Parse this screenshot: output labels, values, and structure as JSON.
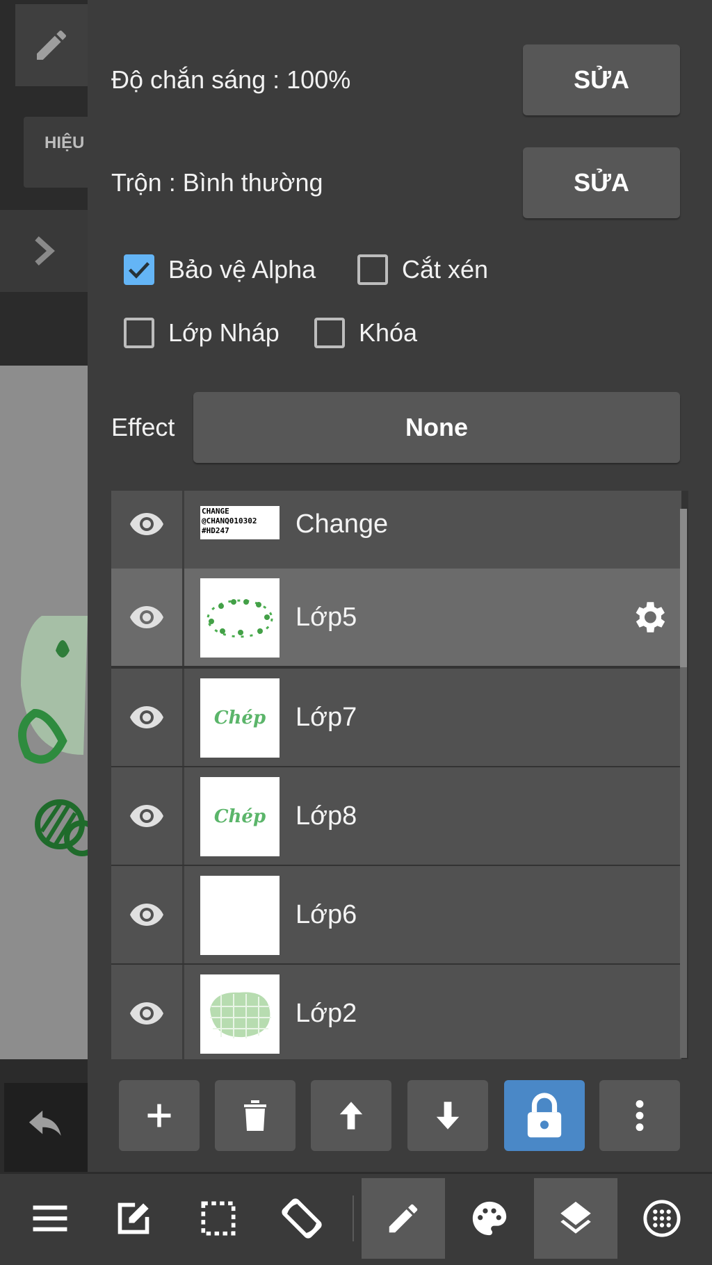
{
  "side_strip": {
    "effect_tab_label": "HIỆU"
  },
  "layer_properties": {
    "opacity_label": "Độ chắn sáng : 100%",
    "opacity_edit": "SỬA",
    "blend_label": "Trộn : Bình thường",
    "blend_edit": "SỬA",
    "checkboxes": [
      {
        "label": "Bảo vệ Alpha",
        "checked": true
      },
      {
        "label": "Cắt xén",
        "checked": false
      },
      {
        "label": "Lớp Nháp",
        "checked": false
      },
      {
        "label": "Khóa",
        "checked": false
      }
    ],
    "effect_label": "Effect",
    "effect_value": "None"
  },
  "layers": [
    {
      "name": "Change",
      "visible": true,
      "selected": false,
      "thumb_text": [
        "CHANGE",
        "@CHANQ010302",
        "#HD247"
      ]
    },
    {
      "name": "Lớp5",
      "visible": true,
      "selected": true
    },
    {
      "name": "Lớp7",
      "visible": true,
      "selected": false,
      "thumb_text": [
        "Chép"
      ]
    },
    {
      "name": "Lớp8",
      "visible": true,
      "selected": false,
      "thumb_text": [
        "Chép"
      ]
    },
    {
      "name": "Lớp6",
      "visible": true,
      "selected": false
    },
    {
      "name": "Lớp2",
      "visible": true,
      "selected": false
    }
  ],
  "layer_actions": [
    {
      "icon": "plus-icon"
    },
    {
      "icon": "trash-icon"
    },
    {
      "icon": "arrow-up-icon"
    },
    {
      "icon": "arrow-down-icon"
    },
    {
      "icon": "lock-icon",
      "active": true
    },
    {
      "icon": "more-vertical-icon"
    }
  ],
  "bottom_nav": [
    {
      "icon": "menu-icon"
    },
    {
      "icon": "edit-square-icon"
    },
    {
      "icon": "selection-icon"
    },
    {
      "icon": "rotate-screen-icon"
    },
    {
      "icon": "pencil-icon",
      "active": true
    },
    {
      "icon": "palette-icon"
    },
    {
      "icon": "layers-icon",
      "active": true
    },
    {
      "icon": "grid-circle-icon"
    }
  ],
  "colors": {
    "panel": "#3c3c3c",
    "button": "#575757",
    "accent_blue": "#4a88c7",
    "checkbox_blue": "#64b5f6",
    "selected_layer": "#6b6b6b"
  }
}
